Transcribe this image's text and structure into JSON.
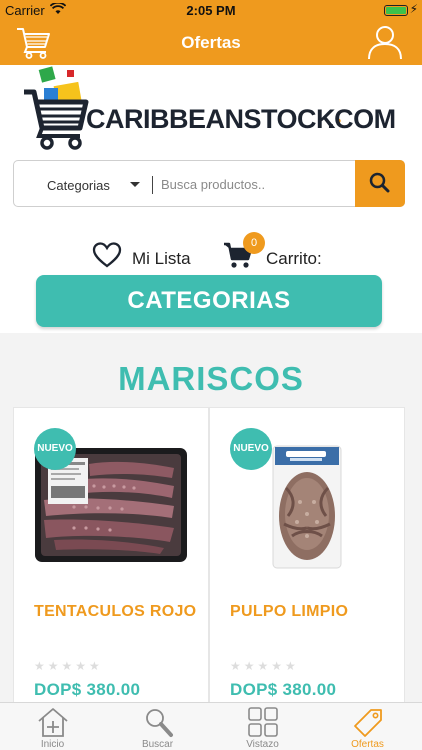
{
  "status_bar": {
    "carrier": "Carrier",
    "time": "2:05 PM"
  },
  "header": {
    "title": "Ofertas"
  },
  "logo": {
    "text_main": "CARIBBEANSTOCK",
    "text_suffix": ".COM"
  },
  "search": {
    "category_label": "Categorias",
    "placeholder": "Busca productos.."
  },
  "actions": {
    "list_label": "Mi Lista",
    "cart_label": "Carrito:",
    "cart_count": "0"
  },
  "categories_button": {
    "label": "CATEGORIAS"
  },
  "section": {
    "title": "MARISCOS"
  },
  "products": [
    {
      "badge": "NUEVO",
      "name": "TENTACULOS ROJO",
      "price": "DOP$ 380.00",
      "rating": "★★★★★"
    },
    {
      "badge": "NUEVO",
      "name": "PULPO LIMPIO",
      "price": "DOP$ 380.00",
      "rating": "★★★★★"
    }
  ],
  "tabs": [
    {
      "label": "Inicio",
      "icon": "home-plus-icon"
    },
    {
      "label": "Buscar",
      "icon": "magnifier-icon"
    },
    {
      "label": "Vistazo",
      "icon": "grid-icon"
    },
    {
      "label": "Ofertas",
      "icon": "tag-icon"
    }
  ],
  "colors": {
    "accent": "#ef9a1e",
    "teal": "#3fbdb0",
    "dark": "#1d2430"
  }
}
